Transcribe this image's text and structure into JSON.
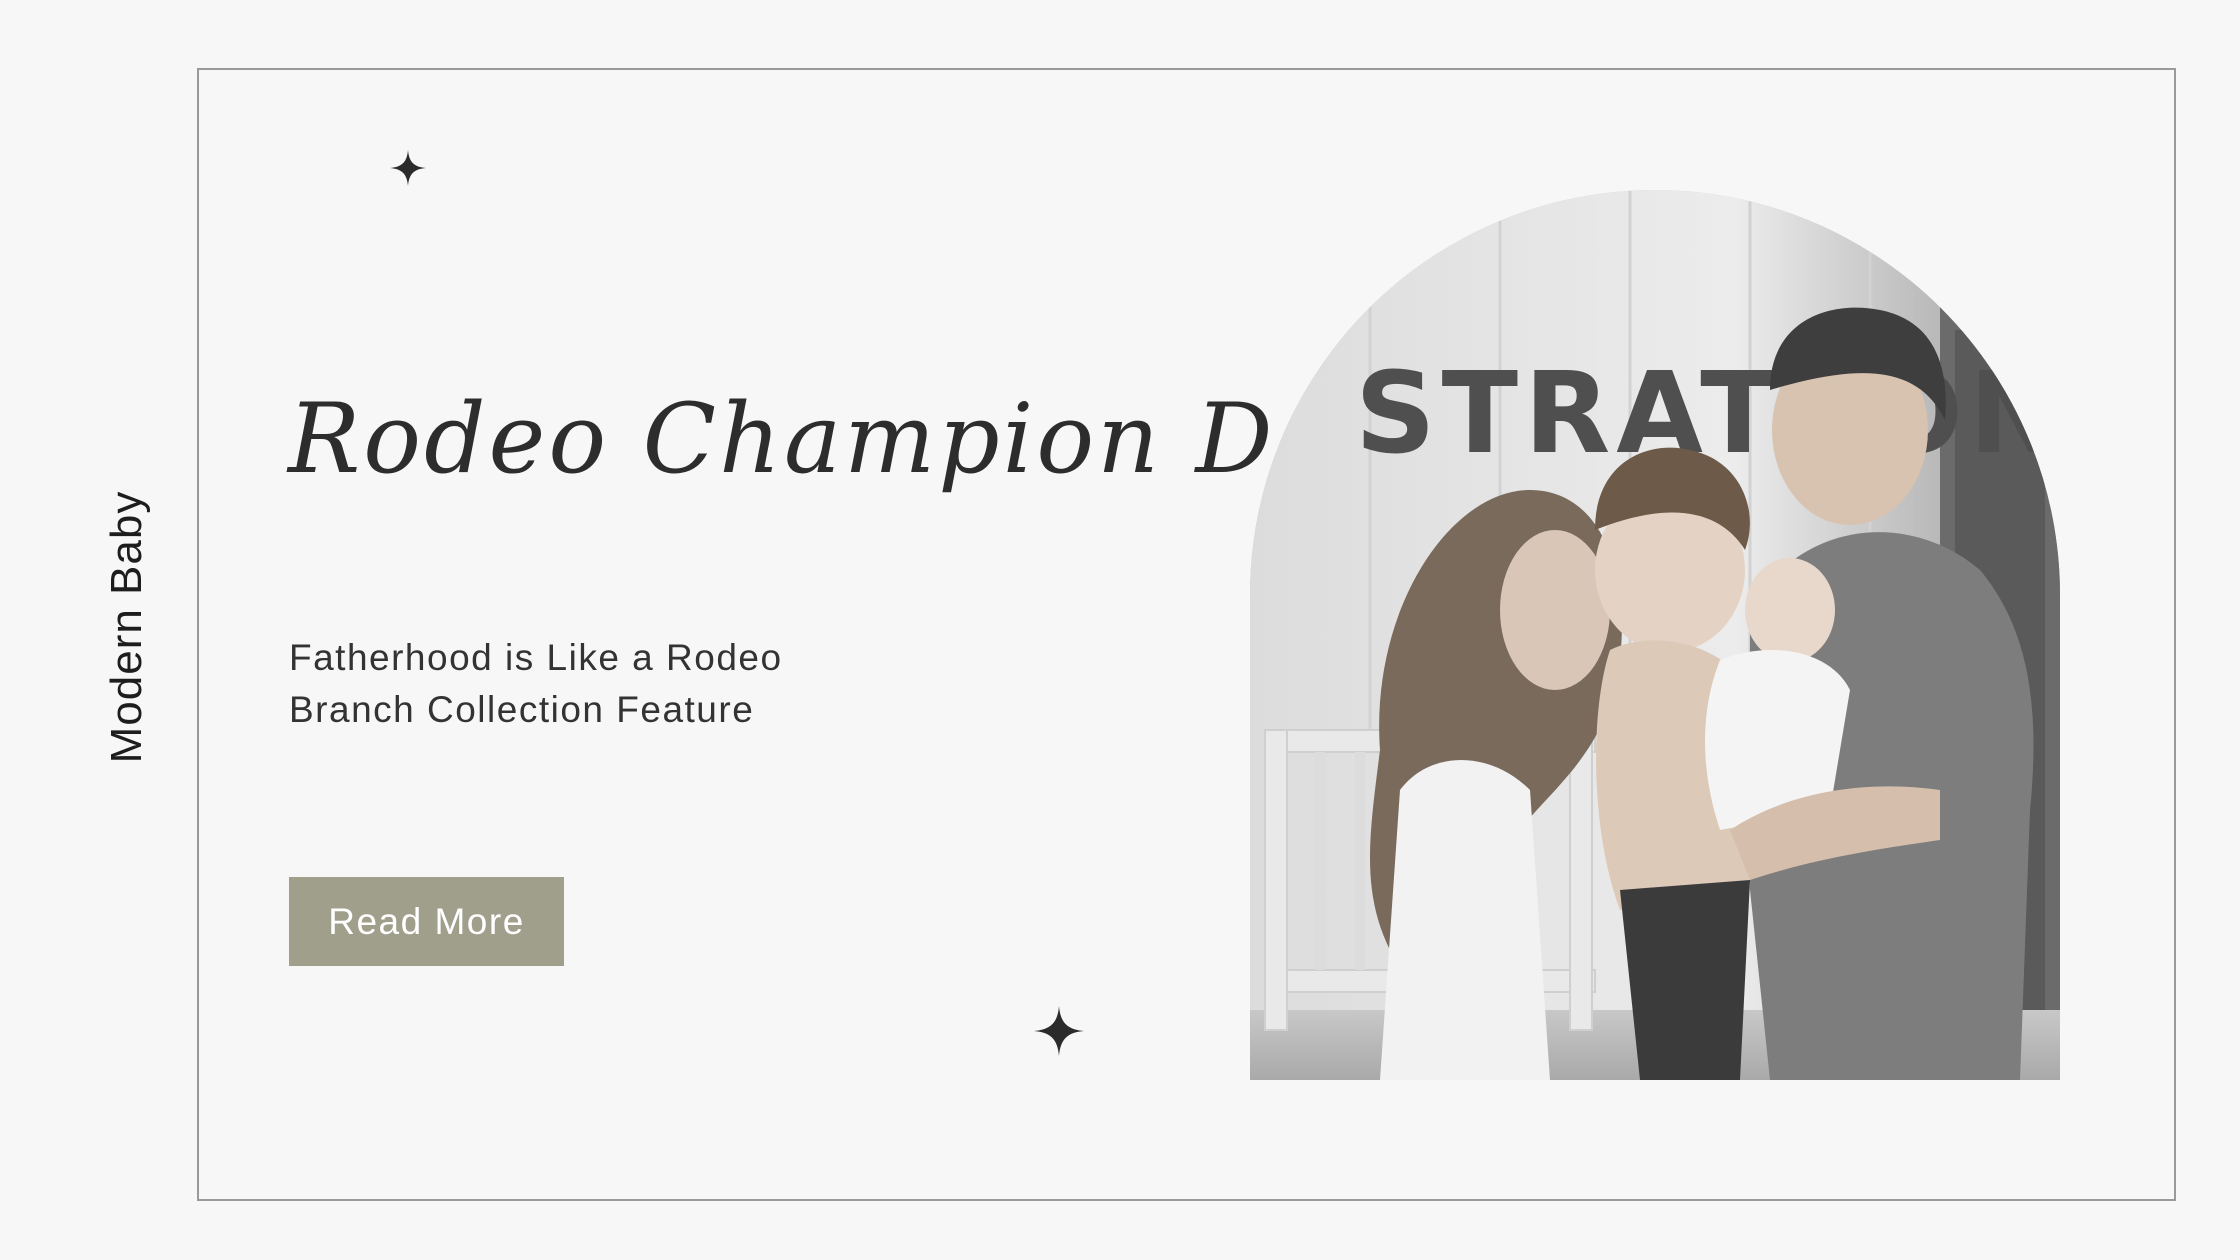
{
  "side_label": "Modern Baby",
  "title": "Rodeo Champion Dad",
  "subtitle": {
    "line1": "Fatherhood is Like a Rodeo",
    "line2": "Branch Collection Feature"
  },
  "button": {
    "label": "Read More"
  },
  "photo": {
    "sign_text": "STRATTON",
    "alt": "Black and white family photo"
  },
  "colors": {
    "background": "#f7f7f7",
    "frame_border": "#9a9a9a",
    "button_bg": "#a09f8c",
    "button_text": "#ffffff",
    "text": "#2d2d2d"
  }
}
